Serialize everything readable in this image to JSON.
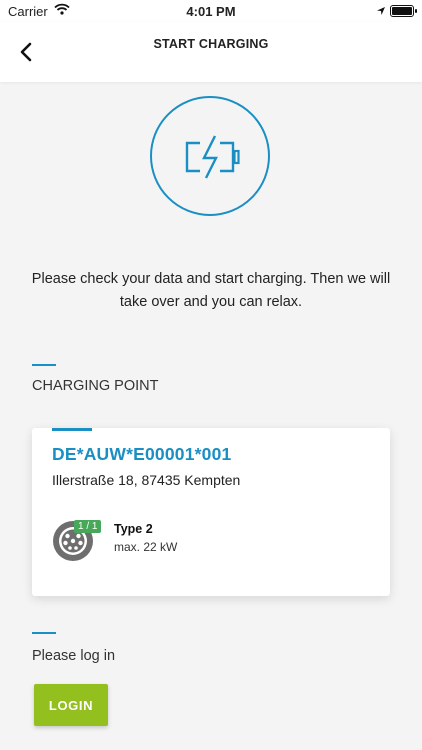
{
  "status_bar": {
    "carrier": "Carrier",
    "time": "4:01 PM"
  },
  "nav": {
    "title": "START CHARGING"
  },
  "intro_text": "Please check your data and start charging. Then we will take over and you can relax.",
  "charging_point": {
    "section_title": "CHARGING POINT",
    "evse_id": "DE*AUW*E00001*001",
    "address": "Illerstraße 18, 87435 Kempten",
    "connector": {
      "availability": "1 / 1",
      "type": "Type 2",
      "power": "max. 22 kW"
    }
  },
  "login": {
    "prompt": "Please log in",
    "button_label": "LOGIN"
  },
  "colors": {
    "accent": "#1a8fc4",
    "login_button": "#93bf1f",
    "available_badge": "#48a85a"
  },
  "icons": {
    "hero": "battery-charging-icon",
    "back": "chevron-left-icon",
    "connector": "type2-plug-icon"
  }
}
